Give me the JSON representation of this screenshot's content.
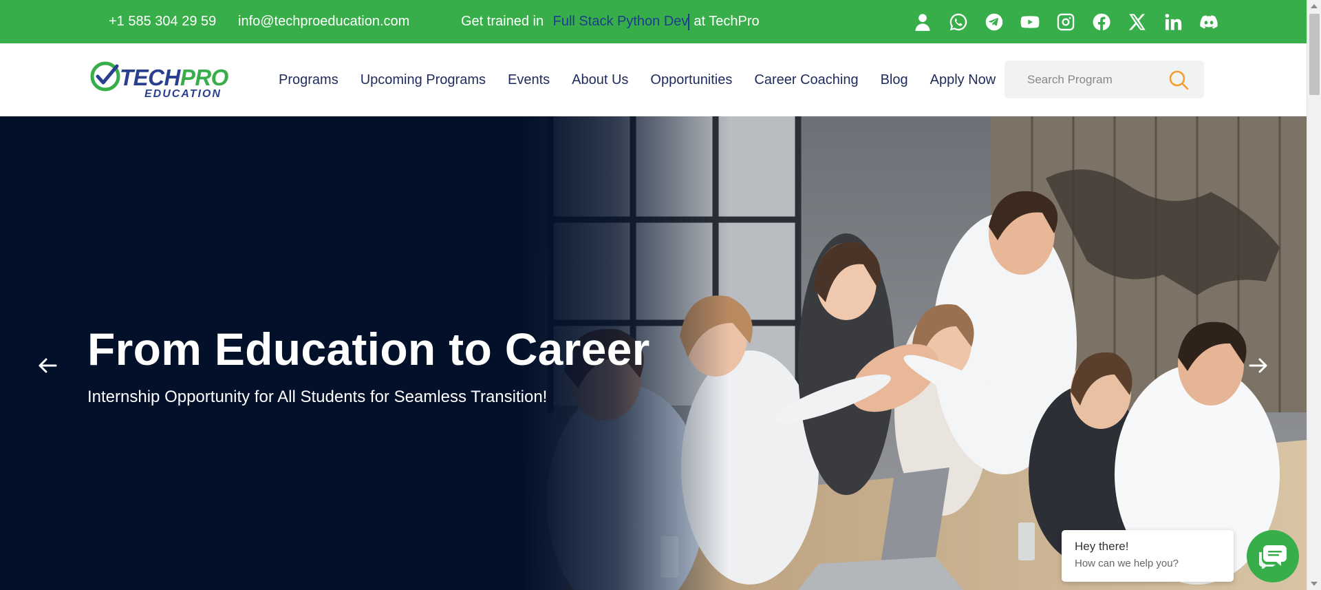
{
  "topbar": {
    "phone": "+1 585 304 29 59",
    "email": "info@techproeducation.com",
    "tagline_prefix": "Get trained in",
    "tagline_typed": "Full Stack Python Dev",
    "tagline_suffix": "at TechPro",
    "social_icons": [
      "user-icon",
      "whatsapp-icon",
      "telegram-icon",
      "youtube-icon",
      "instagram-icon",
      "facebook-icon",
      "x-icon",
      "linkedin-icon",
      "discord-icon"
    ]
  },
  "logo": {
    "name_part1": "TECH",
    "name_part2": "PRO",
    "subtitle": "EDUCATION"
  },
  "nav": {
    "items": [
      "Programs",
      "Upcoming Programs",
      "Events",
      "About Us",
      "Opportunities",
      "Career Coaching",
      "Blog",
      "Apply Now"
    ]
  },
  "search": {
    "placeholder": "Search Program"
  },
  "hero": {
    "title": "From Education to Career",
    "subtitle": "Internship Opportunity for All Students for Seamless Transition!"
  },
  "chat": {
    "greeting": "Hey there!",
    "prompt": "How can we help you?"
  },
  "colors": {
    "brand_green": "#38ae4b",
    "nav_text": "#1e2a5a",
    "hero_bg": "#021029",
    "typed_text": "#1b3e8a",
    "search_icon": "#f39c2a"
  }
}
